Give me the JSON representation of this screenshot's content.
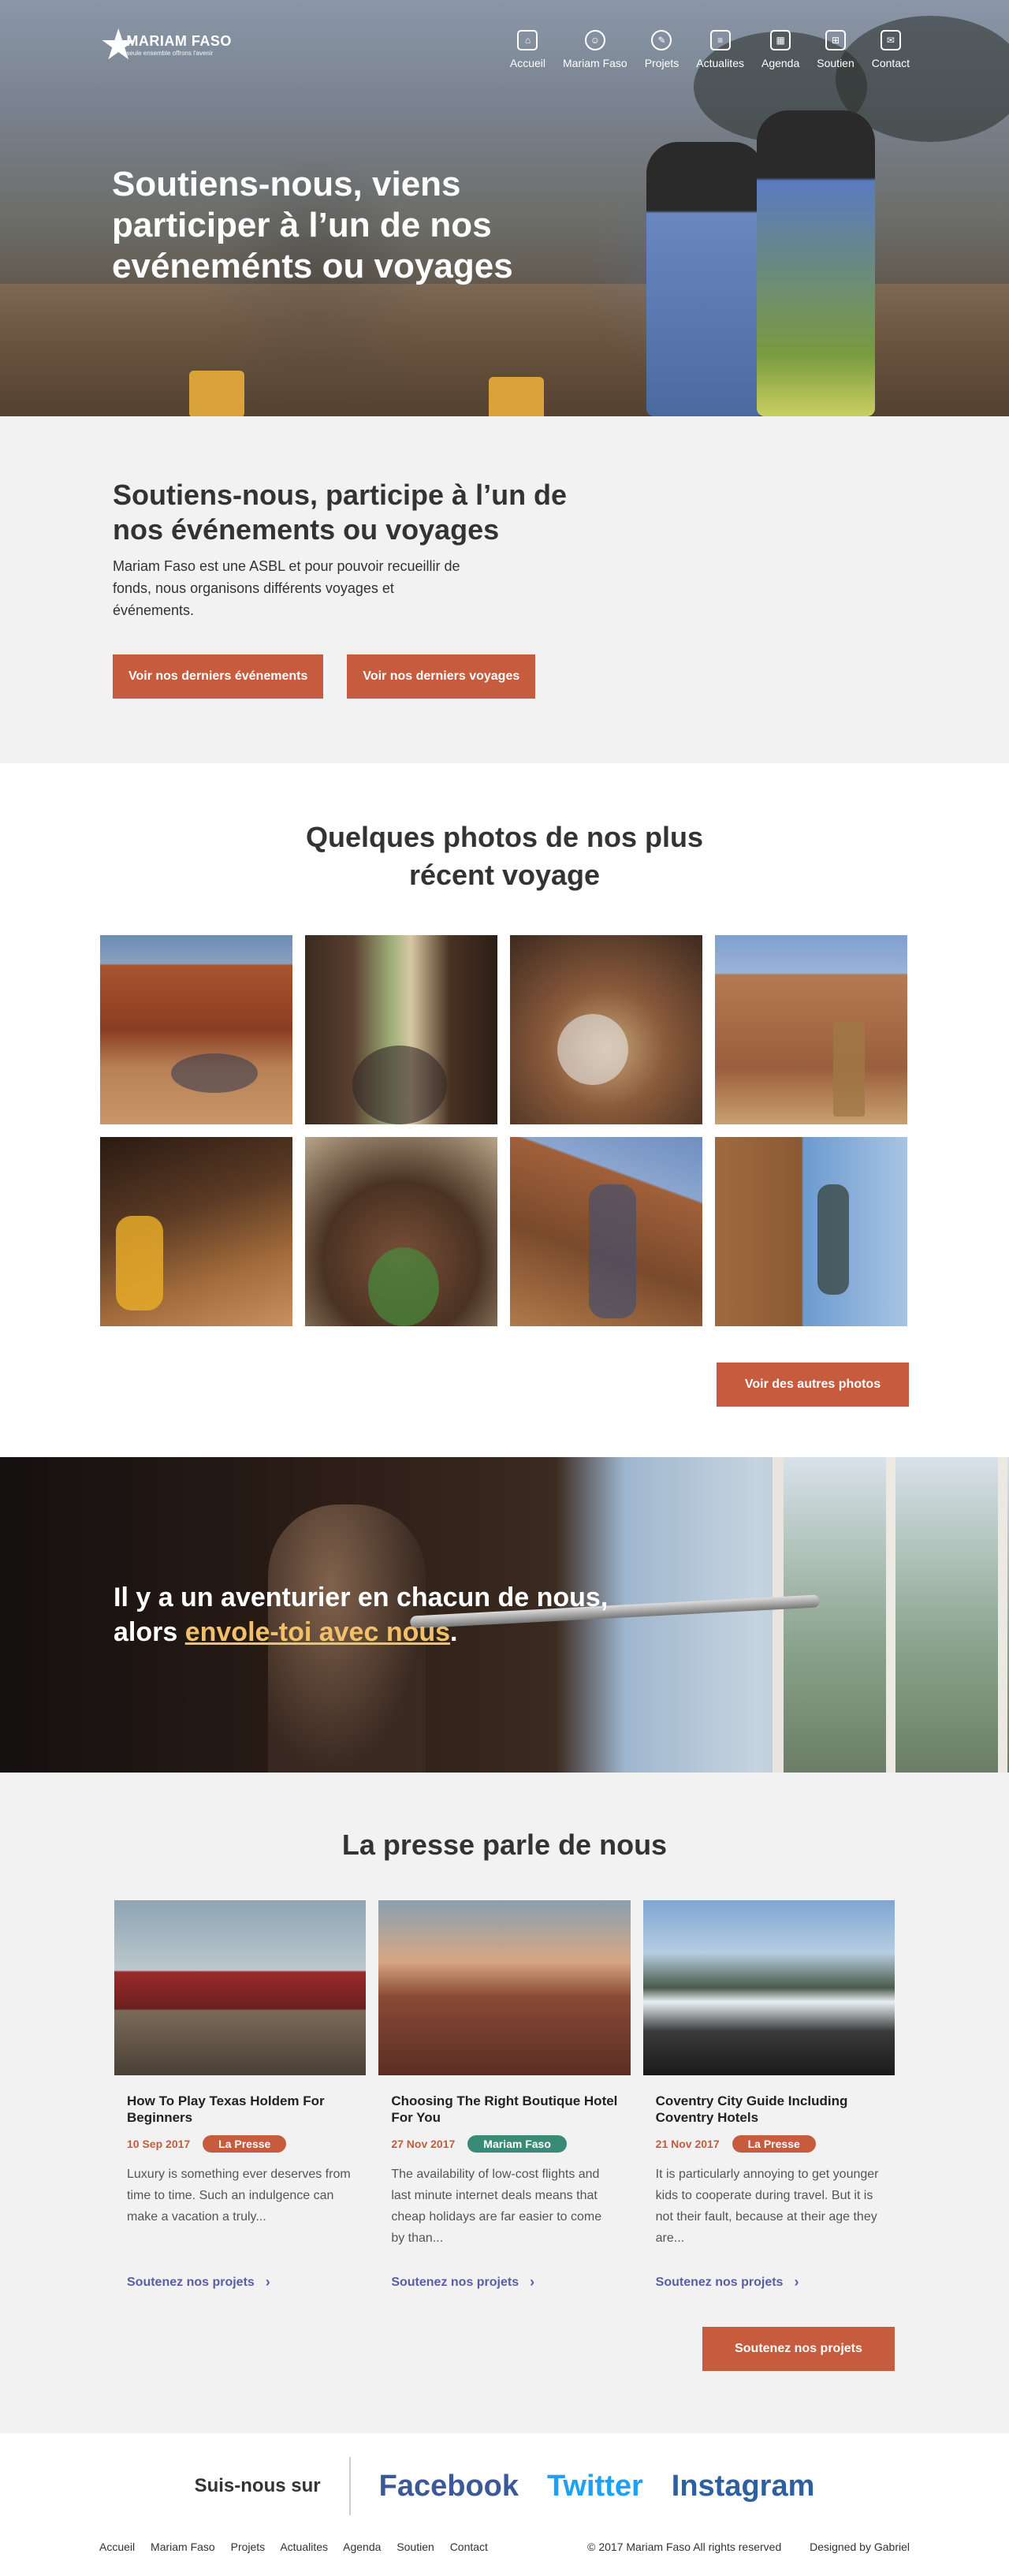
{
  "header": {
    "brand": "MARIAM FASO",
    "tagline": "seule ensemble offrons l'avenir",
    "nav": [
      {
        "label": "Accueil",
        "icon": "home-icon",
        "glyph": "⌂"
      },
      {
        "label": "Mariam Faso",
        "icon": "smiley-icon",
        "glyph": "☺"
      },
      {
        "label": "Projets",
        "icon": "pen-icon",
        "glyph": "✎"
      },
      {
        "label": "Actualites",
        "icon": "document-icon",
        "glyph": "≡"
      },
      {
        "label": "Agenda",
        "icon": "calendar-icon",
        "glyph": "▦"
      },
      {
        "label": "Soutien",
        "icon": "gift-icon",
        "glyph": "⊞"
      },
      {
        "label": "Contact",
        "icon": "envelope-icon",
        "glyph": "✉"
      }
    ]
  },
  "hero": {
    "title": "Soutiens-nous, viens participer à l’un de nos evéneménts ou voyages"
  },
  "intro": {
    "title": "Soutiens-nous, participe à l’un de nos événements ou voyages",
    "text": "Mariam Faso est une ASBL et pour pouvoir recueillir de fonds, nous organisons différents voyages et événements.",
    "btn_events": "Voir nos derniers événements",
    "btn_trips": "Voir nos derniers voyages"
  },
  "photos": {
    "title": "Quelques photos de nos plus récent voyage",
    "more": "Voir des autres photos"
  },
  "banner": {
    "quote_before": "Il y a un aventurier en chacun de nous, alors ",
    "quote_link": "envole-toi avec nous",
    "quote_after": "."
  },
  "press": {
    "title": "La presse parle de nous",
    "cards": [
      {
        "title": "How To Play Texas Holdem For Beginners",
        "date": "10 Sep 2017",
        "badge": "La Presse",
        "badge_color": "#c65b3e",
        "excerpt": "Luxury is something ever  deserves from time to time. Such an indulgence can make a vacation a truly...",
        "link": "Soutenez nos projets"
      },
      {
        "title": "Choosing The Right Boutique Hotel For You",
        "date": "27 Nov 2017",
        "badge": "Mariam Faso",
        "badge_color": "#3a8a78",
        "excerpt": "The availability of low-cost flights and last minute internet deals means that cheap holidays are far easier to come by than...",
        "link": "Soutenez nos projets"
      },
      {
        "title": "Coventry City Guide Including Coventry Hotels",
        "date": "21 Nov 2017",
        "badge": "La Presse",
        "badge_color": "#c65b3e",
        "excerpt": "It is particularly annoying to get younger kids to cooperate during travel. But it is not their fault, because at their age they are...",
        "link": "Soutenez nos projets"
      }
    ],
    "more": "Soutenez nos projets"
  },
  "social": {
    "follow": "Suis-nous sur",
    "networks": [
      {
        "label": "Facebook",
        "color": "#3b5998"
      },
      {
        "label": "Twitter",
        "color": "#1da1f2"
      },
      {
        "label": "Instagram",
        "color": "#2e5f9e"
      }
    ]
  },
  "footer": {
    "links": [
      "Accueil",
      "Mariam Faso",
      "Projets",
      "Actualites",
      "Agenda",
      "Soutien",
      "Contact"
    ],
    "copyright": "© 2017 Mariam Faso All rights reserved",
    "designed": "Designed by Gabriel"
  }
}
